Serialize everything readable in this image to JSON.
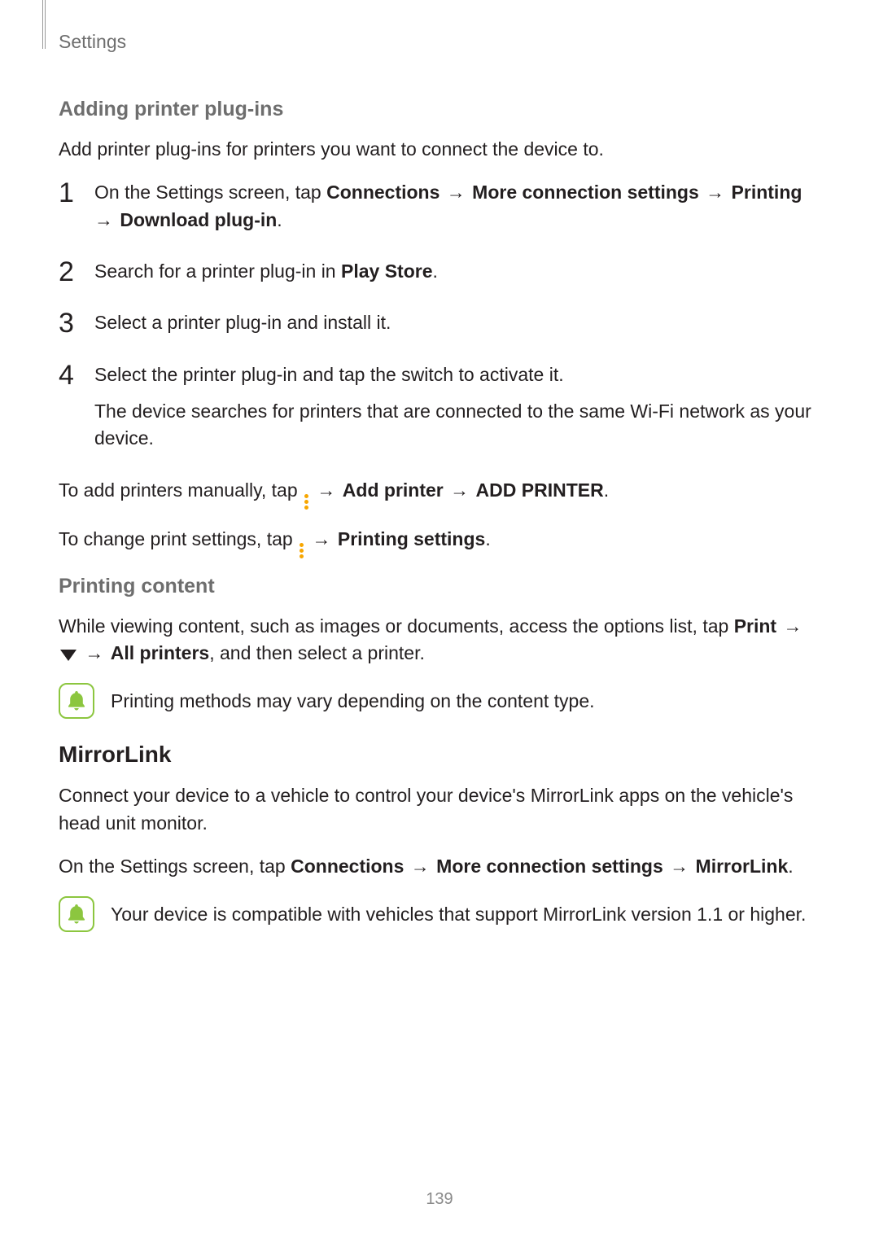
{
  "header": {
    "section": "Settings"
  },
  "s1": {
    "title": "Adding printer plug-ins",
    "intro": "Add printer plug-ins for printers you want to connect the device to.",
    "steps": {
      "n1": "1",
      "n2": "2",
      "n3": "3",
      "n4": "4",
      "s1_a": "On the Settings screen, tap ",
      "s1_b": "Connections",
      "s1_arr": " → ",
      "s1_c": "More connection settings",
      "s1_d": "Printing",
      "s1_e": "Download plug-in",
      "s1_period": ".",
      "s2_a": "Search for a printer plug-in in ",
      "s2_b": "Play Store",
      "s2_c": ".",
      "s3": "Select a printer plug-in and install it.",
      "s4_a": "Select the printer plug-in and tap the switch to activate it.",
      "s4_b": "The device searches for printers that are connected to the same Wi-Fi network as your device."
    },
    "manual_a": "To add printers manually, tap ",
    "manual_b": " → ",
    "manual_c": "Add printer",
    "manual_d": "ADD PRINTER",
    "manual_e": ".",
    "change_a": "To change print settings, tap ",
    "change_b": " → ",
    "change_c": "Printing settings",
    "change_d": "."
  },
  "s2": {
    "title": "Printing content",
    "p1_a": "While viewing content, such as images or documents, access the options list, tap ",
    "p1_b": "Print",
    "p1_arr": " → ",
    "p1_c": " → ",
    "p1_d": "All printers",
    "p1_e": ", and then select a printer.",
    "note": "Printing methods may vary depending on the content type."
  },
  "s3": {
    "title": "MirrorLink",
    "p1": "Connect your device to a vehicle to control your device's MirrorLink apps on the vehicle's head unit monitor.",
    "p2_a": "On the Settings screen, tap ",
    "p2_b": "Connections",
    "p2_arr": " → ",
    "p2_c": "More connection settings",
    "p2_d": "MirrorLink",
    "p2_e": ".",
    "note": "Your device is compatible with vehicles that support MirrorLink version 1.1 or higher."
  },
  "page_number": "139"
}
